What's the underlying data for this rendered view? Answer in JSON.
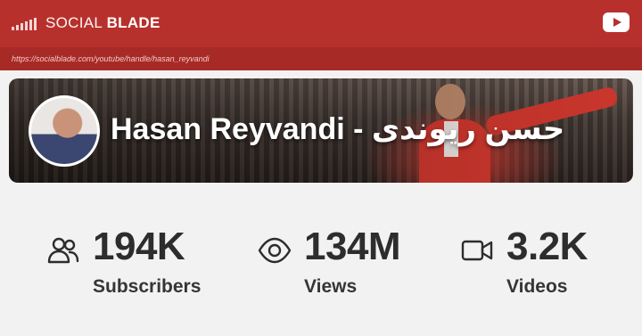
{
  "header": {
    "brand_light": "SOCIAL ",
    "brand_bold": "BLADE",
    "youtube_button": "youtube-icon"
  },
  "url": "https://socialblade.com/youtube/handle/hasan_reyvandi",
  "channel": {
    "name": "Hasan Reyvandi - حسن ریوندی"
  },
  "stats": [
    {
      "icon": "users-icon",
      "value": "194K",
      "label": "Subscribers"
    },
    {
      "icon": "eye-icon",
      "value": "134M",
      "label": "Views"
    },
    {
      "icon": "video-camera-icon",
      "value": "3.2K",
      "label": "Videos"
    }
  ],
  "colors": {
    "header_bg": "#b8302c",
    "urlbar_bg": "#a82a26",
    "page_bg": "#f3f2f2",
    "text_dark": "#2d2d2d"
  }
}
